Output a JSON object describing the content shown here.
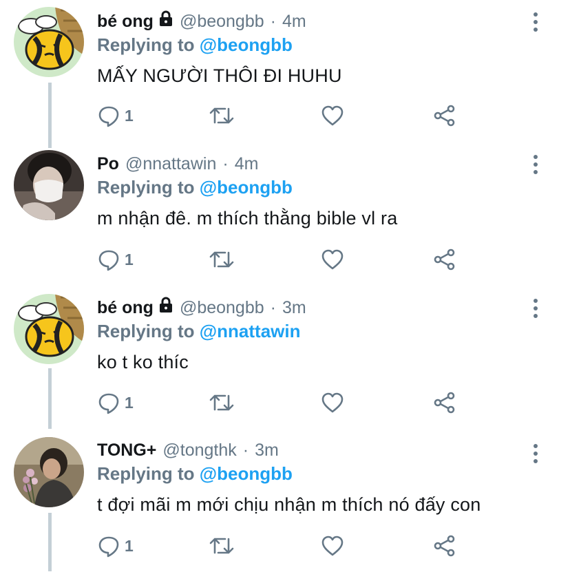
{
  "colors": {
    "accent": "#1da1f2",
    "secondary": "#657786",
    "text": "#14171a",
    "thread": "#c4cfd6"
  },
  "tweets": [
    {
      "name": "bé ong",
      "locked": true,
      "handle": "@beongbb",
      "dot": "·",
      "time": "4m",
      "reply_prefix": "Replying to",
      "reply_user": "@beongbb",
      "text": "MẤY NGƯỜI THÔI ĐI HUHU",
      "reply_count": "1",
      "avatar": "bee-avatar"
    },
    {
      "name": "Po",
      "locked": false,
      "handle": "@nnattawin",
      "dot": "·",
      "time": "4m",
      "reply_prefix": "Replying to",
      "reply_user": "@beongbb",
      "text": "m nhận đê. m thích thằng bible vl ra",
      "reply_count": "1",
      "avatar": "person-mask-avatar"
    },
    {
      "name": "bé ong",
      "locked": true,
      "handle": "@beongbb",
      "dot": "·",
      "time": "3m",
      "reply_prefix": "Replying to",
      "reply_user": "@nnattawin",
      "text": "ko t ko thíc",
      "reply_count": "1",
      "avatar": "bee-avatar"
    },
    {
      "name": "TONG+",
      "locked": false,
      "handle": "@tongthk",
      "dot": "·",
      "time": "3m",
      "reply_prefix": "Replying to",
      "reply_user": "@beongbb",
      "text": "t đợi mãi m mới chịu nhận m thích nó đấy con",
      "reply_count": "1",
      "avatar": "person-flowers-avatar"
    }
  ]
}
